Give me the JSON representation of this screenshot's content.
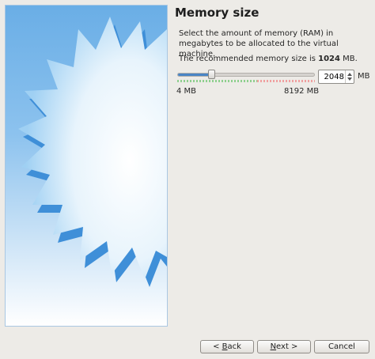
{
  "page": {
    "title": "Memory size",
    "description": "Select the amount of memory (RAM) in megabytes to be allocated to the virtual machine.",
    "recommended_prefix": "The recommended memory size is ",
    "recommended_value": "1024",
    "recommended_suffix": " MB."
  },
  "memory": {
    "value": "2048",
    "unit": "MB",
    "min_label": "4 MB",
    "max_label": "8192 MB",
    "min": 4,
    "max": 8192,
    "current": 2048,
    "recommended_max_fraction": 0.58
  },
  "buttons": {
    "back_prefix": "< ",
    "back_mnemonic": "B",
    "back_rest": "ack",
    "next_mnemonic": "N",
    "next_rest": "ext >",
    "cancel": "Cancel"
  },
  "icons": {
    "side_image": "starburst-banner",
    "spin_up": "arrow-up-icon",
    "spin_down": "arrow-down-icon"
  },
  "colors": {
    "slider_fill": "#4a85c5",
    "safe_ticks": "#8fd08f",
    "danger_ticks": "#f0a0a0"
  }
}
